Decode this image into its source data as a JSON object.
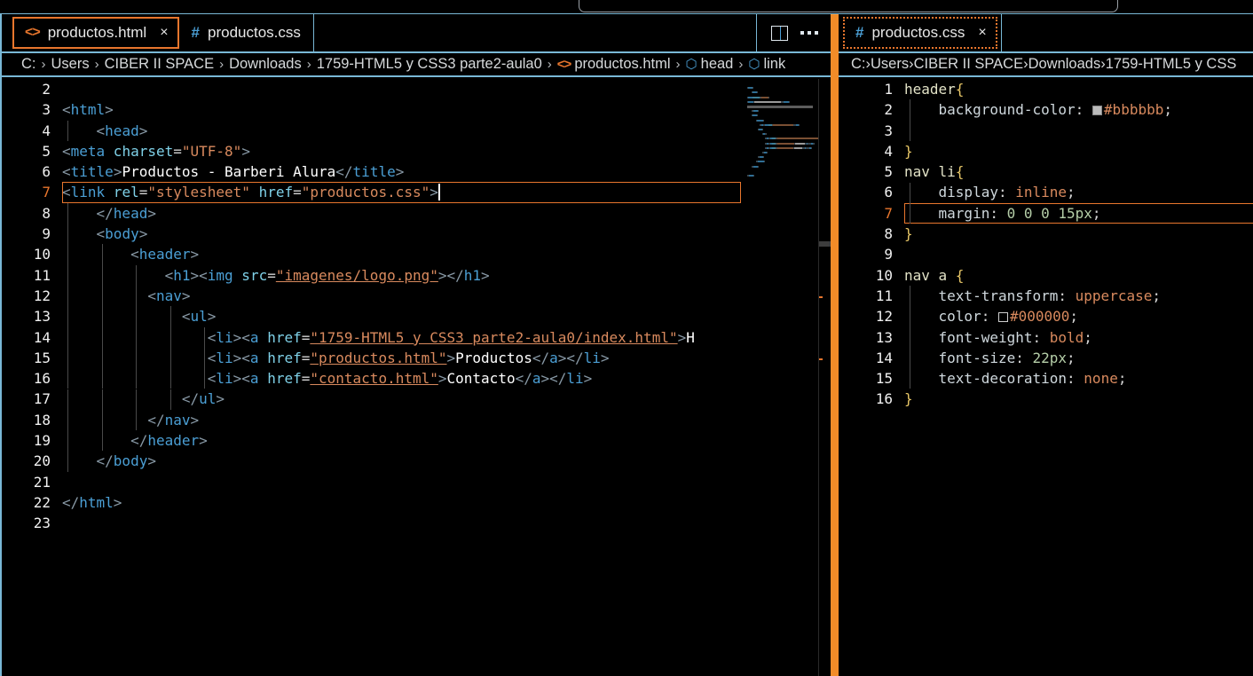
{
  "window": {
    "quick_open_visible": true
  },
  "left_group": {
    "tabs": [
      {
        "label": "productos.html",
        "icon": "html-angle-brackets-icon",
        "active": true,
        "close": "×",
        "dirty": false
      },
      {
        "label": "productos.css",
        "icon": "css-hash-icon",
        "active": false,
        "close": "",
        "dirty": false
      }
    ],
    "actions": [
      {
        "name": "split-editor-icon",
        "label": ""
      },
      {
        "name": "more-actions-icon",
        "label": ""
      }
    ],
    "breadcrumb": [
      {
        "text": "C:",
        "icon": ""
      },
      {
        "text": "Users",
        "icon": ""
      },
      {
        "text": "CIBER II SPACE",
        "icon": ""
      },
      {
        "text": "Downloads",
        "icon": ""
      },
      {
        "text": "1759-HTML5 y CSS3 parte2-aula0",
        "icon": ""
      },
      {
        "text": "productos.html",
        "icon": "html-angle-brackets-icon"
      },
      {
        "text": "head",
        "icon": "symbol-field-icon"
      },
      {
        "text": "link",
        "icon": "symbol-field-icon"
      }
    ],
    "separator": "›",
    "active_line": 7,
    "first_visible_line": 2,
    "lines": [
      {
        "n": 2,
        "blank_partial": true,
        "tokens": []
      },
      {
        "n": 3,
        "tokens": [
          {
            "c": "t-punc",
            "t": "<"
          },
          {
            "c": "t-tag",
            "t": "html"
          },
          {
            "c": "t-punc",
            "t": ">"
          }
        ],
        "indent": 0
      },
      {
        "n": 4,
        "tokens": [
          {
            "c": "t-punc",
            "t": "    <"
          },
          {
            "c": "t-tag",
            "t": "head"
          },
          {
            "c": "t-punc",
            "t": ">"
          }
        ],
        "indent": 1
      },
      {
        "n": 5,
        "tokens": [
          {
            "c": "t-punc",
            "t": "<"
          },
          {
            "c": "t-tag",
            "t": "meta"
          },
          {
            "c": "t-attr",
            "t": " charset"
          },
          {
            "c": "t-eq",
            "t": "="
          },
          {
            "c": "t-str",
            "t": "\"UTF-8\""
          },
          {
            "c": "t-punc",
            "t": ">"
          }
        ],
        "indent": 0
      },
      {
        "n": 6,
        "tokens": [
          {
            "c": "t-punc",
            "t": "<"
          },
          {
            "c": "t-tag",
            "t": "title"
          },
          {
            "c": "t-punc",
            "t": ">"
          },
          {
            "c": "t-text",
            "t": "Productos - Barberi Alura"
          },
          {
            "c": "t-punc",
            "t": "</"
          },
          {
            "c": "t-tag",
            "t": "title"
          },
          {
            "c": "t-punc",
            "t": ">"
          }
        ],
        "indent": 0
      },
      {
        "n": 7,
        "tokens": [
          {
            "c": "t-punc",
            "t": "<"
          },
          {
            "c": "t-tag",
            "t": "link"
          },
          {
            "c": "t-attr",
            "t": " rel"
          },
          {
            "c": "t-eq",
            "t": "="
          },
          {
            "c": "t-str",
            "t": "\"stylesheet\""
          },
          {
            "c": "t-attr",
            "t": " href"
          },
          {
            "c": "t-eq",
            "t": "="
          },
          {
            "c": "t-str",
            "t": "\"productos.css\""
          },
          {
            "c": "t-punc",
            "t": ">"
          }
        ],
        "indent": 0,
        "active": true,
        "cursor_after": true
      },
      {
        "n": 8,
        "tokens": [
          {
            "c": "t-punc",
            "t": "    </"
          },
          {
            "c": "t-tag",
            "t": "head"
          },
          {
            "c": "t-punc",
            "t": ">"
          }
        ],
        "indent": 1
      },
      {
        "n": 9,
        "tokens": [
          {
            "c": "t-punc",
            "t": "    <"
          },
          {
            "c": "t-tag",
            "t": "body"
          },
          {
            "c": "t-punc",
            "t": ">"
          }
        ],
        "indent": 1
      },
      {
        "n": 10,
        "tokens": [
          {
            "c": "t-punc",
            "t": "        <"
          },
          {
            "c": "t-tag",
            "t": "header"
          },
          {
            "c": "t-punc",
            "t": ">"
          }
        ],
        "indent": 2
      },
      {
        "n": 11,
        "tokens": [
          {
            "c": "t-punc",
            "t": "            <"
          },
          {
            "c": "t-tag",
            "t": "h1"
          },
          {
            "c": "t-punc",
            "t": "><"
          },
          {
            "c": "t-tag",
            "t": "img"
          },
          {
            "c": "t-attr",
            "t": " src"
          },
          {
            "c": "t-eq",
            "t": "="
          },
          {
            "c": "t-link",
            "t": "\"imagenes/logo.png\""
          },
          {
            "c": "t-punc",
            "t": "></"
          },
          {
            "c": "t-tag",
            "t": "h1"
          },
          {
            "c": "t-punc",
            "t": ">"
          }
        ],
        "indent": 3
      },
      {
        "n": 12,
        "tokens": [
          {
            "c": "t-punc",
            "t": "          <"
          },
          {
            "c": "t-tag",
            "t": "nav"
          },
          {
            "c": "t-punc",
            "t": ">"
          }
        ],
        "indent": 3
      },
      {
        "n": 13,
        "tokens": [
          {
            "c": "t-punc",
            "t": "              <"
          },
          {
            "c": "t-tag",
            "t": "ul"
          },
          {
            "c": "t-punc",
            "t": ">"
          }
        ],
        "indent": 4
      },
      {
        "n": 14,
        "tokens": [
          {
            "c": "t-punc",
            "t": "                 <"
          },
          {
            "c": "t-tag",
            "t": "li"
          },
          {
            "c": "t-punc",
            "t": "><"
          },
          {
            "c": "t-tag",
            "t": "a"
          },
          {
            "c": "t-attr",
            "t": " href"
          },
          {
            "c": "t-eq",
            "t": "="
          },
          {
            "c": "t-link",
            "t": "\"1759-HTML5 y CSS3 parte2-aula0/index.html\""
          },
          {
            "c": "t-punc",
            "t": ">"
          },
          {
            "c": "t-text",
            "t": "H"
          }
        ],
        "indent": 5
      },
      {
        "n": 15,
        "tokens": [
          {
            "c": "t-punc",
            "t": "                 <"
          },
          {
            "c": "t-tag",
            "t": "li"
          },
          {
            "c": "t-punc",
            "t": "><"
          },
          {
            "c": "t-tag",
            "t": "a"
          },
          {
            "c": "t-attr",
            "t": " href"
          },
          {
            "c": "t-eq",
            "t": "="
          },
          {
            "c": "t-link",
            "t": "\"productos.html\""
          },
          {
            "c": "t-punc",
            "t": ">"
          },
          {
            "c": "t-text",
            "t": "Productos"
          },
          {
            "c": "t-punc",
            "t": "</"
          },
          {
            "c": "t-tag",
            "t": "a"
          },
          {
            "c": "t-punc",
            "t": "></"
          },
          {
            "c": "t-tag",
            "t": "li"
          },
          {
            "c": "t-punc",
            "t": ">"
          }
        ],
        "indent": 5
      },
      {
        "n": 16,
        "tokens": [
          {
            "c": "t-punc",
            "t": "                 <"
          },
          {
            "c": "t-tag",
            "t": "li"
          },
          {
            "c": "t-punc",
            "t": "><"
          },
          {
            "c": "t-tag",
            "t": "a"
          },
          {
            "c": "t-attr",
            "t": " href"
          },
          {
            "c": "t-eq",
            "t": "="
          },
          {
            "c": "t-link",
            "t": "\"contacto.html\""
          },
          {
            "c": "t-punc",
            "t": ">"
          },
          {
            "c": "t-text",
            "t": "Contacto"
          },
          {
            "c": "t-punc",
            "t": "</"
          },
          {
            "c": "t-tag",
            "t": "a"
          },
          {
            "c": "t-punc",
            "t": "></"
          },
          {
            "c": "t-tag",
            "t": "li"
          },
          {
            "c": "t-punc",
            "t": ">"
          }
        ],
        "indent": 5
      },
      {
        "n": 17,
        "tokens": [
          {
            "c": "t-punc",
            "t": "              </"
          },
          {
            "c": "t-tag",
            "t": "ul"
          },
          {
            "c": "t-punc",
            "t": ">"
          }
        ],
        "indent": 4
      },
      {
        "n": 18,
        "tokens": [
          {
            "c": "t-punc",
            "t": "          </"
          },
          {
            "c": "t-tag",
            "t": "nav"
          },
          {
            "c": "t-punc",
            "t": ">"
          }
        ],
        "indent": 3
      },
      {
        "n": 19,
        "tokens": [
          {
            "c": "t-punc",
            "t": "        </"
          },
          {
            "c": "t-tag",
            "t": "header"
          },
          {
            "c": "t-punc",
            "t": ">"
          }
        ],
        "indent": 2
      },
      {
        "n": 20,
        "tokens": [
          {
            "c": "t-punc",
            "t": "    </"
          },
          {
            "c": "t-tag",
            "t": "body"
          },
          {
            "c": "t-punc",
            "t": ">"
          }
        ],
        "indent": 1
      },
      {
        "n": 21,
        "tokens": []
      },
      {
        "n": 22,
        "tokens": [
          {
            "c": "t-punc",
            "t": "</"
          },
          {
            "c": "t-tag",
            "t": "html"
          },
          {
            "c": "t-punc",
            "t": ">"
          }
        ],
        "indent": 0
      },
      {
        "n": 23,
        "tokens": []
      }
    ]
  },
  "right_group": {
    "tabs": [
      {
        "label": "productos.css",
        "icon": "css-hash-icon",
        "active": true,
        "close": "×"
      }
    ],
    "breadcrumb": [
      {
        "text": "C:",
        "icon": ""
      },
      {
        "text": "Users",
        "icon": ""
      },
      {
        "text": "CIBER II SPACE",
        "icon": ""
      },
      {
        "text": "Downloads",
        "icon": ""
      },
      {
        "text": "1759-HTML5 y CSS",
        "icon": ""
      }
    ],
    "separator": "›",
    "active_line": 7,
    "lines": [
      {
        "n": 1,
        "tokens": [
          {
            "c": "t-sel",
            "t": "header"
          },
          {
            "c": "t-brace",
            "t": "{"
          }
        ],
        "indent": 0
      },
      {
        "n": 2,
        "tokens": [
          {
            "c": "t-prop",
            "t": "    background-color"
          },
          {
            "c": "t-eq",
            "t": ": "
          },
          {
            "c": "swatch",
            "t": "#bbbbbb"
          },
          {
            "c": "t-val",
            "t": "#bbbbbb"
          },
          {
            "c": "t-eq",
            "t": ";"
          }
        ],
        "indent": 1
      },
      {
        "n": 3,
        "tokens": [],
        "indent": 1
      },
      {
        "n": 4,
        "tokens": [
          {
            "c": "t-brace",
            "t": "}"
          }
        ],
        "indent": 0
      },
      {
        "n": 5,
        "tokens": [
          {
            "c": "t-sel",
            "t": "nav li"
          },
          {
            "c": "t-brace",
            "t": "{"
          }
        ],
        "indent": 0
      },
      {
        "n": 6,
        "tokens": [
          {
            "c": "t-prop",
            "t": "    display"
          },
          {
            "c": "t-eq",
            "t": ": "
          },
          {
            "c": "t-val",
            "t": "inline"
          },
          {
            "c": "t-eq",
            "t": ";"
          }
        ],
        "indent": 1
      },
      {
        "n": 7,
        "tokens": [
          {
            "c": "t-prop",
            "t": "    margin"
          },
          {
            "c": "t-eq",
            "t": ": "
          },
          {
            "c": "t-num",
            "t": "0 0 0 15px"
          },
          {
            "c": "t-eq",
            "t": ";"
          }
        ],
        "indent": 1,
        "active": true
      },
      {
        "n": 8,
        "tokens": [
          {
            "c": "t-brace",
            "t": "}"
          }
        ],
        "indent": 0
      },
      {
        "n": 9,
        "tokens": [],
        "indent": 0
      },
      {
        "n": 10,
        "tokens": [
          {
            "c": "t-sel",
            "t": "nav a "
          },
          {
            "c": "t-brace",
            "t": "{"
          }
        ],
        "indent": 0
      },
      {
        "n": 11,
        "tokens": [
          {
            "c": "t-prop",
            "t": "    text-transform"
          },
          {
            "c": "t-eq",
            "t": ": "
          },
          {
            "c": "t-val",
            "t": "uppercase"
          },
          {
            "c": "t-eq",
            "t": ";"
          }
        ],
        "indent": 1
      },
      {
        "n": 12,
        "tokens": [
          {
            "c": "t-prop",
            "t": "    color"
          },
          {
            "c": "t-eq",
            "t": ": "
          },
          {
            "c": "swatch-dark",
            "t": "#000000"
          },
          {
            "c": "t-val",
            "t": "#000000"
          },
          {
            "c": "t-eq",
            "t": ";"
          }
        ],
        "indent": 1
      },
      {
        "n": 13,
        "tokens": [
          {
            "c": "t-prop",
            "t": "    font-weight"
          },
          {
            "c": "t-eq",
            "t": ": "
          },
          {
            "c": "t-val",
            "t": "bold"
          },
          {
            "c": "t-eq",
            "t": ";"
          }
        ],
        "indent": 1
      },
      {
        "n": 14,
        "tokens": [
          {
            "c": "t-prop",
            "t": "    font-size"
          },
          {
            "c": "t-eq",
            "t": ": "
          },
          {
            "c": "t-num",
            "t": "22px"
          },
          {
            "c": "t-eq",
            "t": ";"
          }
        ],
        "indent": 1
      },
      {
        "n": 15,
        "tokens": [
          {
            "c": "t-prop",
            "t": "    text-decoration"
          },
          {
            "c": "t-eq",
            "t": ": "
          },
          {
            "c": "t-val",
            "t": "none"
          },
          {
            "c": "t-eq",
            "t": ";"
          }
        ],
        "indent": 1
      },
      {
        "n": 16,
        "tokens": [
          {
            "c": "t-brace",
            "t": "}"
          }
        ],
        "indent": 0
      }
    ]
  },
  "colors": {
    "accent_orange": "#e8762d",
    "divider_orange": "#f28c28",
    "rule_blue": "#79b8d6",
    "editor_bg": "#000000",
    "css_icon_blue": "#4b9fd5"
  }
}
